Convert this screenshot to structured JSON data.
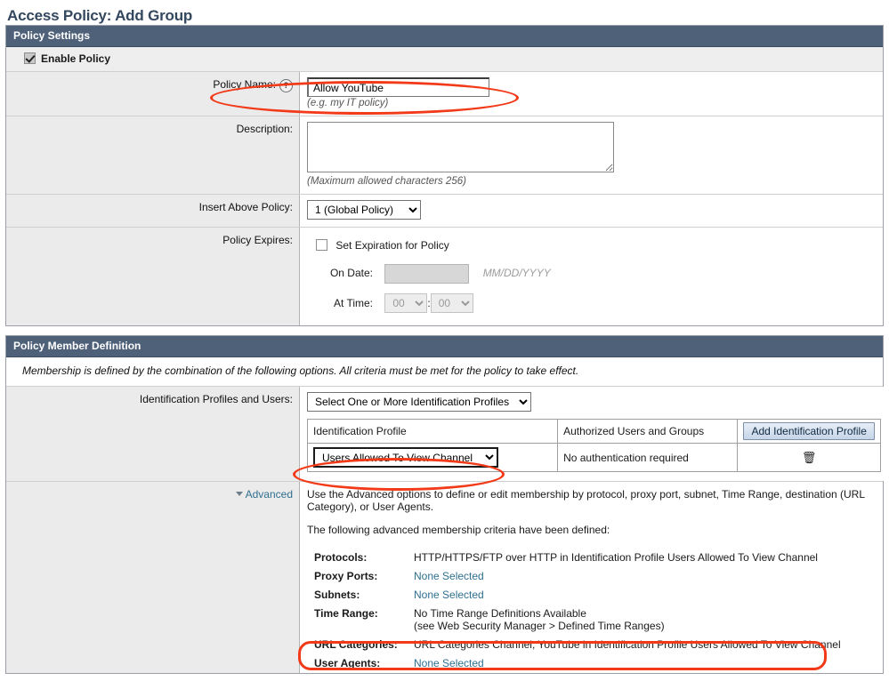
{
  "page": {
    "title": "Access Policy: Add Group"
  },
  "policy_settings": {
    "header": "Policy Settings",
    "enable_policy": {
      "label": "Enable Policy",
      "checked": true
    },
    "policy_name": {
      "label": "Policy Name:",
      "help_icon": "question-mark-icon",
      "value": "Allow YouTube",
      "hint": "(e.g. my IT policy)"
    },
    "description": {
      "label": "Description:",
      "value": "",
      "hint": "(Maximum allowed characters 256)"
    },
    "insert_above_policy": {
      "label": "Insert Above Policy:",
      "selected": "1 (Global Policy)",
      "options": [
        "1 (Global Policy)"
      ]
    },
    "policy_expires": {
      "label": "Policy Expires:",
      "set_expiration": {
        "label": "Set Expiration for Policy",
        "checked": false
      },
      "on_date": {
        "label": "On Date:",
        "value": "",
        "format_hint": "MM/DD/YYYY"
      },
      "at_time": {
        "label": "At Time:",
        "hours": "00",
        "separator": ":",
        "minutes": "00"
      }
    }
  },
  "policy_member_definition": {
    "header": "Policy Member Definition",
    "note": "Membership is defined by the combination of the following options. All criteria must be met for the policy to take effect.",
    "identification": {
      "label": "Identification Profiles and Users:",
      "select_profiles": {
        "selected": "Select One or More Identification Profiles",
        "options": [
          "Select One or More Identification Profiles"
        ]
      },
      "table": {
        "columns": [
          "Identification Profile",
          "Authorized Users and Groups"
        ],
        "add_button": "Add Identification Profile",
        "rows": [
          {
            "profile": "Users Allowed To View Channel",
            "authorized": "No authentication required",
            "delete_icon": "trash-icon"
          }
        ]
      }
    },
    "advanced": {
      "label": "Advanced",
      "toggle_icon": "chevron-down-icon",
      "description": "Use the Advanced options to define or edit membership by protocol, proxy port, subnet, Time Range, destination (URL Category), or User Agents.",
      "subheading": "The following advanced membership criteria have been defined:",
      "criteria": [
        {
          "key": "Protocols:",
          "value": "HTTP/HTTPS/FTP over HTTP in Identification Profile Users Allowed To View Channel",
          "link": false
        },
        {
          "key": "Proxy Ports:",
          "value": "None Selected",
          "link": true
        },
        {
          "key": "Subnets:",
          "value": "None Selected",
          "link": true
        },
        {
          "key": "Time Range:",
          "value": "No Time Range Definitions Available",
          "value2": "(see Web Security Manager > Defined Time Ranges)",
          "link": false
        },
        {
          "key": "URL Categories:",
          "value": "URL Categories Channel, YouTube in Identification Profile Users Allowed To View Channel",
          "link": false
        },
        {
          "key": "User Agents:",
          "value": "None Selected",
          "link": true
        }
      ]
    }
  },
  "annotations": {
    "color": "#f23a19",
    "highlights": [
      "policy-name-field",
      "identification-profile-select",
      "url-categories-row"
    ]
  }
}
